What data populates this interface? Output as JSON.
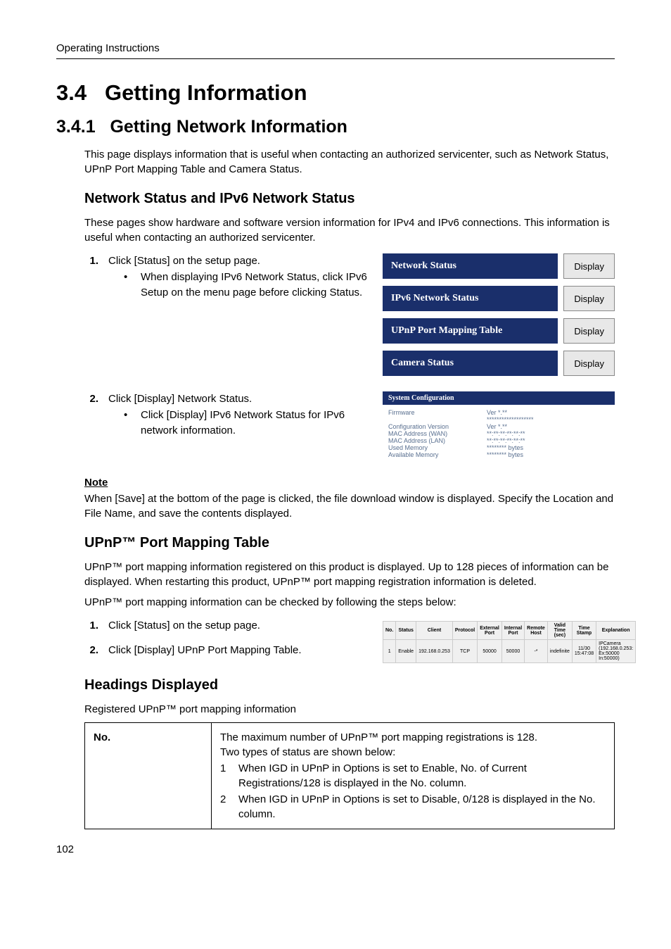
{
  "header": {
    "title": "Operating Instructions"
  },
  "section_main": {
    "number": "3.4",
    "title": "Getting Information"
  },
  "section_sub": {
    "number": "3.4.1",
    "title": "Getting Network Information"
  },
  "intro": "This page displays information that is useful when contacting an authorized servicenter, such as Network Status, UPnP Port Mapping Table and Camera Status.",
  "net_status": {
    "heading": "Network Status and IPv6 Network Status",
    "desc": "These pages show hardware and software version information for IPv4 and IPv6 connections. This information is useful when contacting an authorized servicenter.",
    "step1_num": "1.",
    "step1": "Click [Status] on the setup page.",
    "step1_bullet": "When displaying IPv6 Network Status, click IPv6 Setup on the menu page before clicking Status.",
    "step2_num": "2.",
    "step2": "Click [Display] Network Status.",
    "step2_bullet": "Click [Display] IPv6 Network Status for IPv6 network information."
  },
  "panel": {
    "rows": [
      {
        "label": "Network Status",
        "btn": "Display"
      },
      {
        "label": "IPv6 Network Status",
        "btn": "Display"
      },
      {
        "label": "UPnP Port Mapping Table",
        "btn": "Display"
      },
      {
        "label": "Camera Status",
        "btn": "Display"
      }
    ]
  },
  "sysconf": {
    "title": "System Configuration",
    "rows": [
      {
        "k": "Firmware",
        "v": "Ver *.**"
      },
      {
        "k": "",
        "v": "*******************"
      },
      {
        "k": "Configuration Version",
        "v": "Ver *.**"
      },
      {
        "k": "MAC Address (WAN)",
        "v": "**:**:**:**:**:**"
      },
      {
        "k": "MAC Address (LAN)",
        "v": "**:**:**:**:**:**"
      },
      {
        "k": "Used Memory",
        "v": "******** bytes"
      },
      {
        "k": "Available Memory",
        "v": "******** bytes"
      }
    ]
  },
  "note": {
    "heading": "Note",
    "text": "When [Save] at the bottom of the page is clicked, the file download window is displayed. Specify the Location and File Name, and save the contents displayed."
  },
  "upnp": {
    "heading": "UPnP™ Port Mapping Table",
    "p1": "UPnP™ port mapping information registered on this product is displayed. Up to 128 pieces of information can be displayed. When restarting this product, UPnP™ port mapping registration information is deleted.",
    "p2": "UPnP™ port mapping information can be checked by following the steps below:",
    "step1_num": "1.",
    "step1": "Click [Status] on the setup page.",
    "step2_num": "2.",
    "step2": "Click [Display] UPnP Port Mapping Table."
  },
  "upnp_table": {
    "headers": [
      "No.",
      "Status",
      "Client",
      "Protocol",
      "External Port",
      "Internal Port",
      "Remote Host",
      "Valid Time (sec)",
      "Time Stamp",
      "Explanation"
    ],
    "row": [
      "1",
      "Enable",
      "192.168.0.253",
      "TCP",
      "50000",
      "50000",
      "-*",
      "indefinite",
      "11/30 15:47:08",
      "IPCamera (192.168.0.253: Ex:50000 In:50000)"
    ]
  },
  "headings": {
    "heading": "Headings Displayed",
    "desc": "Registered UPnP™ port mapping information",
    "col1": "No.",
    "line1": "The maximum number of UPnP™ port mapping registrations is 128.",
    "line2": "Two types of status are shown below:",
    "item1_num": "1",
    "item1": "When IGD in UPnP in Options is set to Enable, No. of Current Registrations/128 is displayed in the No. column.",
    "item2_num": "2",
    "item2": "When IGD in UPnP in Options is set to Disable, 0/128 is displayed in the No. column."
  },
  "page_number": "102"
}
